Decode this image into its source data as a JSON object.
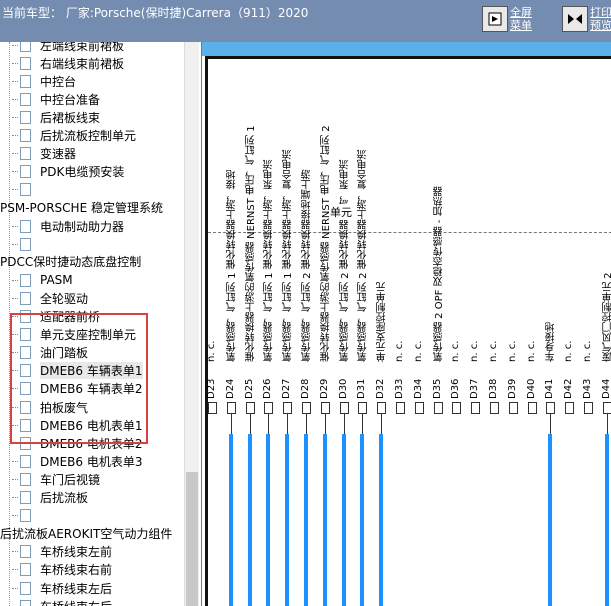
{
  "header": {
    "car_label": "当前车型：  厂家:Porsche(保时捷)Carrera（911）2020",
    "fullscreen_label": "全屏菜单",
    "print_label": "打印预览"
  },
  "tree": {
    "items": [
      {
        "label": "左端线束前裙板",
        "indent": 1
      },
      {
        "label": "右端线束前裙板",
        "indent": 1
      },
      {
        "label": "中控台",
        "indent": 1
      },
      {
        "label": "中控台准备",
        "indent": 1
      },
      {
        "label": "后裙板线束",
        "indent": 1
      },
      {
        "label": "后扰流板控制单元",
        "indent": 1
      },
      {
        "label": "变速器",
        "indent": 1
      },
      {
        "label": "PDK电缆预安装",
        "indent": 1
      },
      {
        "label": "",
        "indent": 1
      },
      {
        "label": "PSM-PORSCHE 稳定管理系统",
        "indent": 0
      },
      {
        "label": "电动制动助力器",
        "indent": 1
      },
      {
        "label": "",
        "indent": 1
      },
      {
        "label": "PDCC保时捷动态底盘控制",
        "indent": 0
      },
      {
        "label": "PASM",
        "indent": 1
      },
      {
        "label": "全轮驱动",
        "indent": 1
      },
      {
        "label": "适配器前桥",
        "indent": 1
      },
      {
        "label": "单元支座控制单元",
        "indent": 1
      },
      {
        "label": "油门踏板",
        "indent": 1
      },
      {
        "label": "DMEB6 车辆表单1",
        "indent": 1,
        "selected": true
      },
      {
        "label": "DMEB6 车辆表单2",
        "indent": 1
      },
      {
        "label": "拍板废气",
        "indent": 1
      },
      {
        "label": "DMEB6 电机表单1",
        "indent": 1
      },
      {
        "label": "DMEB6 电机表单2",
        "indent": 1
      },
      {
        "label": "DMEB6 电机表单3",
        "indent": 1
      },
      {
        "label": "车门后视镜",
        "indent": 1
      },
      {
        "label": "后扰流板",
        "indent": 1
      },
      {
        "label": "",
        "indent": 1
      },
      {
        "label": "后扰流板AEROKIT空气动力组件",
        "indent": 0
      },
      {
        "label": "车桥线束左前",
        "indent": 1
      },
      {
        "label": "车桥线束右前",
        "indent": 1
      },
      {
        "label": "车桥线束左后",
        "indent": 1
      },
      {
        "label": "车桥线束右后",
        "indent": 1
      }
    ]
  },
  "diagram": {
    "columns": [
      {
        "pin": "D23",
        "desc": "n. c."
      },
      {
        "pin": "D24",
        "desc": "氧传感器，气缸列 1 催化转换器上游，接地"
      },
      {
        "pin": "D25",
        "desc": "催化转换器上游的氧传感器 NERNST 电压，气缸列 1"
      },
      {
        "pin": "D26",
        "desc": "氧传感器，气缸列 1 催化转换器上游，泵电流"
      },
      {
        "pin": "D27",
        "desc": "氧传感器，气缸列 1 催化转换器上游，复合电流"
      },
      {
        "pin": "D28",
        "desc": "氧传感器，气缸列 2 催化转换器接地端上游"
      },
      {
        "pin": "D29",
        "desc": "催化转换器上游的氧传感器 NERNST 电压，气缸列 2"
      },
      {
        "pin": "D30",
        "desc": "氧传感器，气缸列 2 催化转换器上游，泵电流"
      },
      {
        "pin": "D31",
        "desc": "氧传感器，气缸列 2 催化转换器上游，复合电流"
      },
      {
        "pin": "D32",
        "desc": "单元支座控制单元"
      },
      {
        "pin": "D33",
        "desc": "n. c."
      },
      {
        "pin": "D34",
        "desc": "n. c."
      },
      {
        "pin": "D35",
        "desc": "氧传感器 2 OPF 双稳态传感器 - 加热器"
      },
      {
        "pin": "D36",
        "desc": "n. c."
      },
      {
        "pin": "D37",
        "desc": "n. c."
      },
      {
        "pin": "D38",
        "desc": "n. c."
      },
      {
        "pin": "D39",
        "desc": "n. c."
      },
      {
        "pin": "D40",
        "desc": "n. c."
      },
      {
        "pin": "D41",
        "desc": "车身接地"
      },
      {
        "pin": "D42",
        "desc": "n. c."
      },
      {
        "pin": "D43",
        "desc": "n. c."
      },
      {
        "pin": "D44",
        "desc": "废气风门控制单元 2"
      }
    ],
    "wired_pins": [
      "D24",
      "D25",
      "D26",
      "D27",
      "D28",
      "D29",
      "D30",
      "D31",
      "D32",
      "D41",
      "D44"
    ],
    "wire_color": "#1e90ff",
    "annotation": "单元"
  },
  "colors": {
    "topbar": "#738cb0",
    "highlight_box": "#d94040",
    "diagram_strip": "#5ab0e8"
  }
}
